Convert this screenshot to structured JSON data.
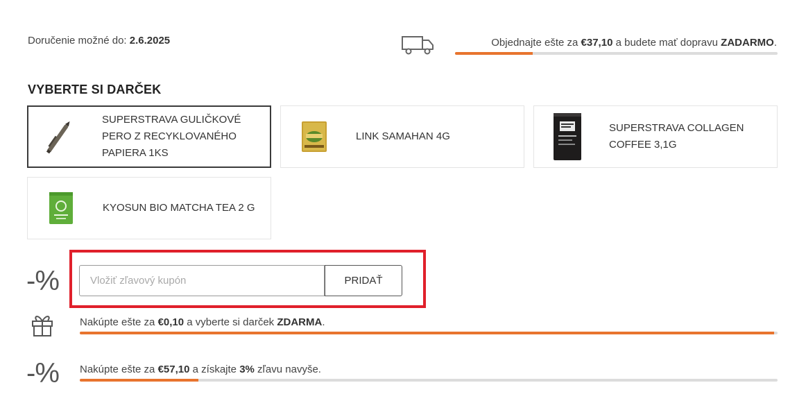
{
  "delivery": {
    "label": "Doručenie možné do:",
    "date": "2.6.2025"
  },
  "shipping": {
    "pre": "Objednajte ešte za",
    "amount": "€37,10",
    "mid": "a budete mať dopravu",
    "strong": "ZADARMO",
    "post": ".",
    "progress": 0.24
  },
  "gifts": {
    "title": "VYBERTE SI DARČEK",
    "items": [
      {
        "name": "SUPERSTRAVA GULIČKOVÉ PERO Z RECYKLOVANÉHO PAPIERA 1KS",
        "icon": "pen-icon",
        "selected": true
      },
      {
        "name": "LINK SAMAHAN 4G",
        "icon": "sachet-icon",
        "selected": false
      },
      {
        "name": "SUPERSTRAVA COLLAGEN COFFEE 3,1G",
        "icon": "coffee-bag-icon",
        "selected": false
      },
      {
        "name": "KYOSUN BIO MATCHA TEA 2 G",
        "icon": "matcha-sachet-icon",
        "selected": false
      }
    ]
  },
  "coupon": {
    "symbol": "-%",
    "placeholder": "Vložiť zľavový kupón",
    "button": "PRIDAŤ"
  },
  "gift_progress": {
    "pre": "Nakúpte ešte za",
    "amount": "€0,10",
    "mid": "a vyberte si darček",
    "strong": "ZDARMA",
    "post": ".",
    "progress": 0.995
  },
  "discount_progress": {
    "symbol": "-%",
    "pre": "Nakúpte ešte za",
    "amount": "€57,10",
    "mid": "a získajte",
    "strong": "3%",
    "post": "zľavu navyše.",
    "progress": 0.17
  },
  "colors": {
    "accent": "#e8742e",
    "highlight": "#e0202b",
    "track": "#dcdcdc"
  }
}
